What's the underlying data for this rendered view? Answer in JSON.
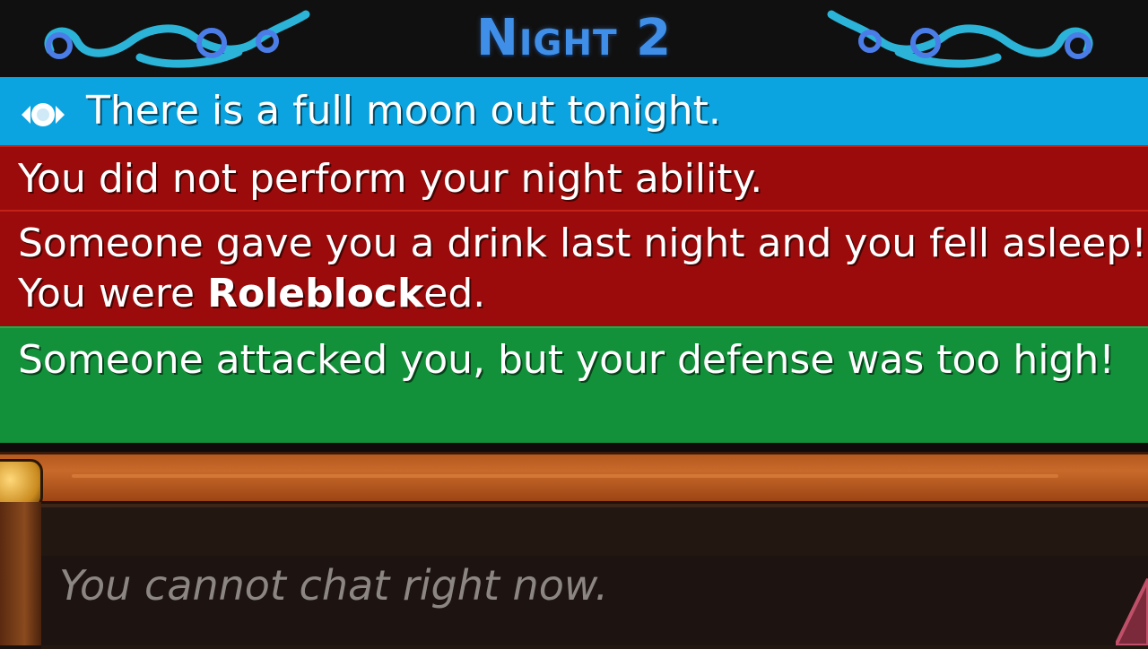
{
  "header": {
    "title": "Night 2"
  },
  "messages": {
    "full_moon": "There is a full moon out tonight.",
    "no_ability": "You did not perform your night ability.",
    "drink_prefix": "Someone gave you a drink last night and you fell asleep! You were ",
    "drink_bold": "Roleblock",
    "drink_suffix": "ed.",
    "attack": "Someone attacked you, but your defense was too high!"
  },
  "colors": {
    "title": "#3f8fe8",
    "full_moon_bg": "#0ca4e0",
    "negative_bg": "#9b0b0b",
    "positive_bg": "#13903a",
    "wood": "#c86a2a",
    "chat_bg": "#1d1411"
  },
  "icons": {
    "moon": "full-moon-icon",
    "ornament": "swirl-ornament-icon",
    "menu_knob": "scroll-knob-icon",
    "corner": "warning-triangle-icon"
  },
  "chat": {
    "placeholder": "You cannot chat right now."
  }
}
